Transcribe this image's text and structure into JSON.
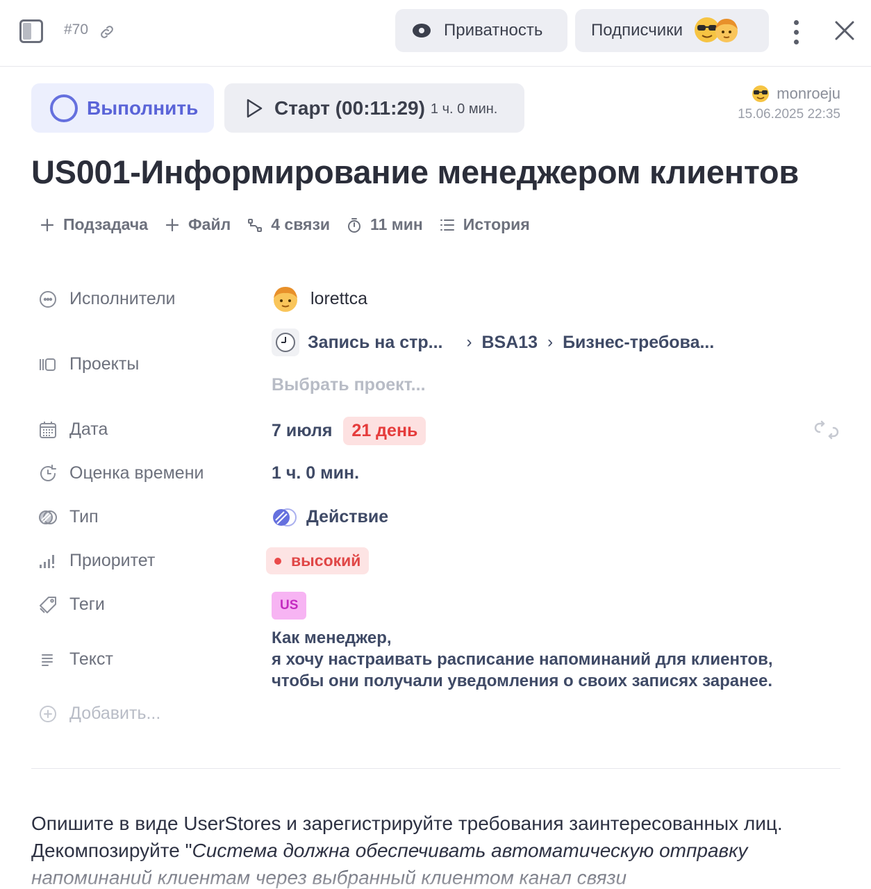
{
  "header": {
    "task_id": "#70",
    "privacy_label": "Приватность",
    "subscribers_label": "Подписчики"
  },
  "actions": {
    "done_label": "Выполнить",
    "start_label": "Старт (00:11:29)",
    "start_estimate": "1 ч. 0 мин."
  },
  "author": {
    "name": "monroeju",
    "date": "15.06.2025 22:35"
  },
  "title": "US001-Информирование менеджером клиентов",
  "toolbar": {
    "subtask": "Подзадача",
    "file": "Файл",
    "links": "4 связи",
    "time": "11 мин",
    "history": "История"
  },
  "fields": {
    "assignees_label": "Исполнители",
    "assignee_name": "lorettca",
    "projects_label": "Проекты",
    "project_path": [
      "Запись на стр...",
      "BSA13",
      "Бизнес-требова..."
    ],
    "project_placeholder": "Выбрать проект...",
    "date_label": "Дата",
    "date_value": "7 июля",
    "overdue_badge": "21 день",
    "estimate_label": "Оценка времени",
    "estimate_value": "1 ч. 0 мин.",
    "type_label": "Тип",
    "type_value": "Действие",
    "priority_label": "Приоритет",
    "priority_value": "высокий",
    "tags_label": "Теги",
    "tag_value": "US",
    "text_label": "Текст",
    "text_lines": [
      "Как менеджер,",
      "я хочу настраивать расписание напоминаний для клиентов,",
      "чтобы они получали уведомления о своих записях заранее."
    ],
    "add_label": "Добавить..."
  },
  "description": {
    "plain_start": "Опишите в виде UserStores и зарегистрируйте требования заинтересованных лиц. Декомпозируйте \"",
    "italic": "Система должна обеспечивать автоматическую отправку напоминаний клиентам через выбранный клиентом канал связи"
  },
  "colors": {
    "accent": "#5a64d8",
    "overdue_bg": "#fde1e1",
    "overdue_text": "#e53b3b",
    "priority_text": "#e04747",
    "tag_bg": "#f7b4f3",
    "tag_text": "#c42ac1"
  },
  "icons": {
    "panel": "panel-toggle-icon",
    "link": "link-icon",
    "privacy": "eye-icon",
    "more": "more-vertical-icon",
    "close": "close-icon",
    "done": "circle-icon",
    "start": "play-icon"
  }
}
